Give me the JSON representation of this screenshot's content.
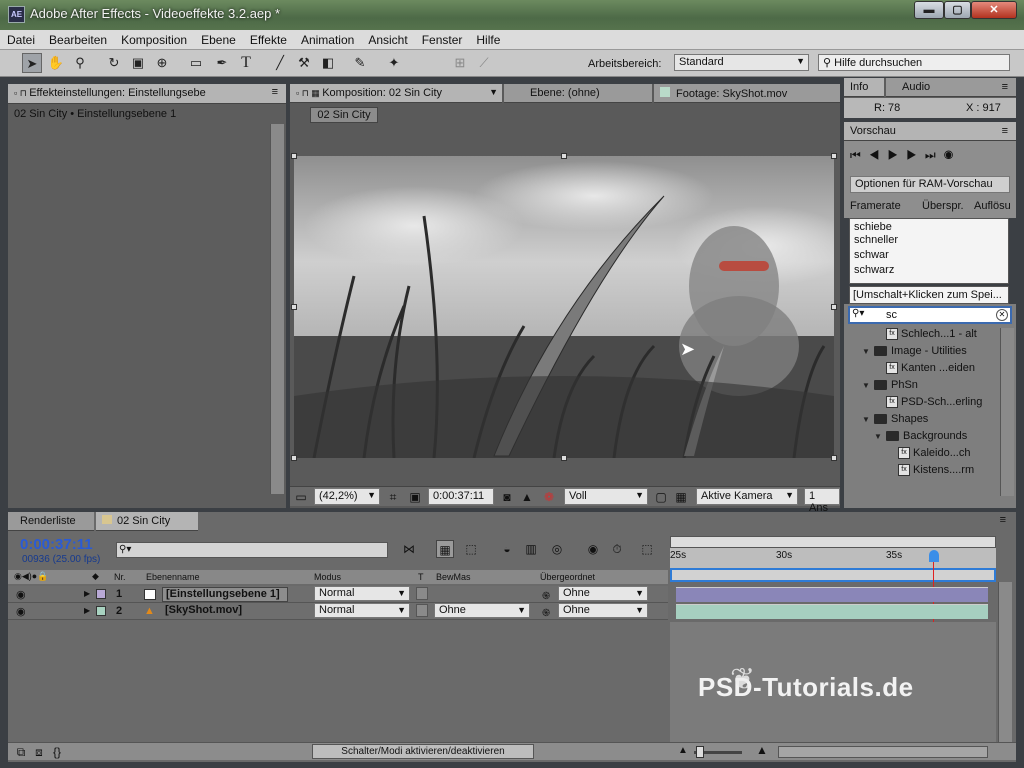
{
  "window": {
    "icon_text": "AE",
    "title": "Adobe After Effects - Videoeffekte 3.2.aep *",
    "minimize": "▬",
    "maximize": "▢",
    "close": "✕"
  },
  "menu": [
    "Datei",
    "Bearbeiten",
    "Komposition",
    "Ebene",
    "Effekte",
    "Animation",
    "Ansicht",
    "Fenster",
    "Hilfe"
  ],
  "toolbar": {
    "workspace_label": "Arbeitsbereich:",
    "workspace_value": "Standard",
    "help_search": "Hilfe durchsuchen"
  },
  "effects_panel": {
    "tab": "Effekteinstellungen: Einstellungsebe",
    "path": "02 Sin City • Einstellungsebene 1"
  },
  "comp_panel": {
    "tab_comp": "Komposition: 02 Sin City",
    "tab_layer": "Ebene: (ohne)",
    "tab_footage": "Footage: SkyShot.mov",
    "subtab": "02 Sin City",
    "zoom": "(42,2%)",
    "timecode": "0:00:37:11",
    "resolution": "Voll",
    "camera": "Aktive Kamera",
    "views": "1 Ans"
  },
  "info_panel": {
    "tab_info": "Info",
    "tab_audio": "Audio",
    "r_value": "R:  78",
    "x_value": "X : 917"
  },
  "preview_panel": {
    "tab": "Vorschau",
    "ram_options": "Optionen für RAM-Vorschau",
    "framerate": "Framerate",
    "skip": "Überspr.",
    "resolution": "Auflösu"
  },
  "autocomplete": {
    "items": [
      "schiebe",
      "schneller",
      "schwar",
      "schwarz"
    ],
    "hint": "[Umschalt+Klicken zum Spei..."
  },
  "effects_search": {
    "value": "sc"
  },
  "effects_tree": [
    {
      "indent": 3,
      "type": "fx",
      "label": "Schlech...1 - alt"
    },
    {
      "indent": 1,
      "type": "folder",
      "label": "Image - Utilities"
    },
    {
      "indent": 3,
      "type": "fx",
      "label": "Kanten ...eiden"
    },
    {
      "indent": 1,
      "type": "folder",
      "label": "PhSn"
    },
    {
      "indent": 3,
      "type": "fx",
      "label": "PSD-Sch...erling"
    },
    {
      "indent": 1,
      "type": "folder",
      "label": "Shapes"
    },
    {
      "indent": 2,
      "type": "folder",
      "label": "Backgrounds"
    },
    {
      "indent": 4,
      "type": "fx",
      "label": "Kaleido...ch"
    },
    {
      "indent": 4,
      "type": "fx",
      "label": "Kistens....rm"
    }
  ],
  "timeline": {
    "tab_render": "Renderliste",
    "tab_comp": "02 Sin City",
    "timecode": "0:00:37:11",
    "frames": "00936 (25.00 fps)",
    "col_nr": "Nr.",
    "col_name": "Ebenenname",
    "col_mode": "Modus",
    "col_t": "T",
    "col_trkmat": "BewMas",
    "col_parent": "Übergeordnet",
    "ticks": [
      "25s",
      "30s",
      "35s"
    ],
    "toggle_label": "Schalter/Modi aktivieren/deaktivieren",
    "layers": [
      {
        "nr": "1",
        "name": "[Einstellungsebene 1]",
        "mode": "Normal",
        "trkmat": "",
        "parent": "Ohne",
        "color": "#b9a9d6",
        "bar": "#8a86b8"
      },
      {
        "nr": "2",
        "name": "[SkyShot.mov]",
        "mode": "Normal",
        "trkmat": "Ohne",
        "parent": "Ohne",
        "color": "#a8d2c0",
        "bar": "#a6cfc0"
      }
    ]
  },
  "watermark": "PSD-Tutorials.de"
}
